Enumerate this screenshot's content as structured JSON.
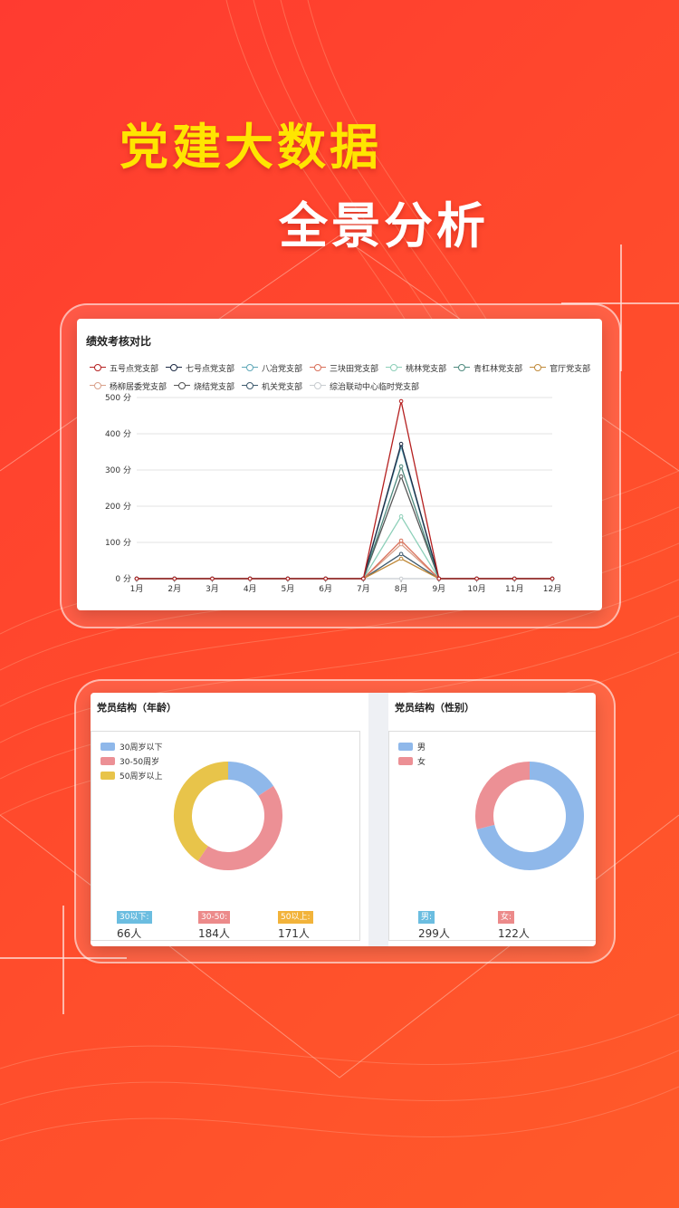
{
  "headline": {
    "line1": "党建大数据",
    "line2": "全景分析"
  },
  "performance_card": {
    "title": "绩效考核对比",
    "legend": [
      {
        "name": "五号点党支部",
        "color": "#b52020"
      },
      {
        "name": "七号点党支部",
        "color": "#1d2a44"
      },
      {
        "name": "八冶党支部",
        "color": "#5fa8b8"
      },
      {
        "name": "三块田党支部",
        "color": "#d9705a"
      },
      {
        "name": "桃林党支部",
        "color": "#8ccfb8"
      },
      {
        "name": "青杠林党支部",
        "color": "#4e8a7e"
      },
      {
        "name": "官厅党支部",
        "color": "#c08a3a"
      },
      {
        "name": "杨柳居委党支部",
        "color": "#d9a08a"
      },
      {
        "name": "烧结党支部",
        "color": "#555555"
      },
      {
        "name": "机关党支部",
        "color": "#3e5a6e"
      },
      {
        "name": "综治联动中心临时党支部",
        "color": "#c8ccd0"
      }
    ]
  },
  "chart_data": {
    "type": "line",
    "title": "绩效考核对比",
    "categories": [
      "1月",
      "2月",
      "3月",
      "4月",
      "5月",
      "6月",
      "7月",
      "8月",
      "9月",
      "10月",
      "11月",
      "12月"
    ],
    "y_ticks": [
      "0 分",
      "100 分",
      "200 分",
      "300 分",
      "400 分",
      "500 分"
    ],
    "ylim": [
      0,
      500
    ],
    "series": [
      {
        "name": "五号点党支部",
        "color": "#b52020",
        "values": [
          0,
          0,
          0,
          0,
          0,
          0,
          0,
          490,
          0,
          0,
          0,
          0
        ]
      },
      {
        "name": "七号点党支部",
        "color": "#1d2a44",
        "values": [
          0,
          0,
          0,
          0,
          0,
          0,
          0,
          372,
          0,
          0,
          0,
          0
        ]
      },
      {
        "name": "八冶党支部",
        "color": "#5fa8b8",
        "values": [
          0,
          0,
          0,
          0,
          0,
          0,
          0,
          365,
          0,
          0,
          0,
          0
        ]
      },
      {
        "name": "三块田党支部",
        "color": "#d9705a",
        "values": [
          0,
          0,
          0,
          0,
          0,
          0,
          0,
          105,
          0,
          0,
          0,
          0
        ]
      },
      {
        "name": "桃林党支部",
        "color": "#8ccfb8",
        "values": [
          0,
          0,
          0,
          0,
          0,
          0,
          0,
          172,
          0,
          0,
          0,
          0
        ]
      },
      {
        "name": "青杠林党支部",
        "color": "#4e8a7e",
        "values": [
          0,
          0,
          0,
          0,
          0,
          0,
          0,
          310,
          0,
          0,
          0,
          0
        ]
      },
      {
        "name": "官厅党支部",
        "color": "#c08a3a",
        "values": [
          0,
          0,
          0,
          0,
          0,
          0,
          0,
          55,
          0,
          0,
          0,
          0
        ]
      },
      {
        "name": "杨柳居委党支部",
        "color": "#d9a08a",
        "values": [
          0,
          0,
          0,
          0,
          0,
          0,
          0,
          95,
          0,
          0,
          0,
          0
        ]
      },
      {
        "name": "烧结党支部",
        "color": "#555555",
        "values": [
          0,
          0,
          0,
          0,
          0,
          0,
          0,
          282,
          0,
          0,
          0,
          0
        ]
      },
      {
        "name": "机关党支部",
        "color": "#3e5a6e",
        "values": [
          0,
          0,
          0,
          0,
          0,
          0,
          0,
          68,
          0,
          0,
          0,
          0
        ]
      },
      {
        "name": "综治联动中心临时党支部",
        "color": "#c8ccd0",
        "values": [
          0,
          0,
          0,
          0,
          0,
          0,
          0,
          0,
          0,
          0,
          0,
          0
        ]
      }
    ]
  },
  "age_panel": {
    "title": "党员结构（年龄）",
    "legend": [
      {
        "name": "30周岁以下",
        "color": "#8fb8ea"
      },
      {
        "name": "30-50周岁",
        "color": "#ec9095"
      },
      {
        "name": "50周岁以上",
        "color": "#e8c44a"
      }
    ],
    "stats": [
      {
        "label": "30以下:",
        "value": "66人",
        "count": 66,
        "color": "#6bbde0"
      },
      {
        "label": "30-50:",
        "value": "184人",
        "count": 184,
        "color": "#ec8a8a"
      },
      {
        "label": "50以上:",
        "value": "171人",
        "count": 171,
        "color": "#f2b33a"
      }
    ]
  },
  "gender_panel": {
    "title": "党员结构（性别）",
    "legend": [
      {
        "name": "男",
        "color": "#8fb8ea"
      },
      {
        "name": "女",
        "color": "#ec9095"
      }
    ],
    "stats": [
      {
        "label": "男:",
        "value": "299人",
        "count": 299,
        "color": "#6bbde0"
      },
      {
        "label": "女:",
        "value": "122人",
        "count": 122,
        "color": "#ec8a8a"
      }
    ]
  }
}
